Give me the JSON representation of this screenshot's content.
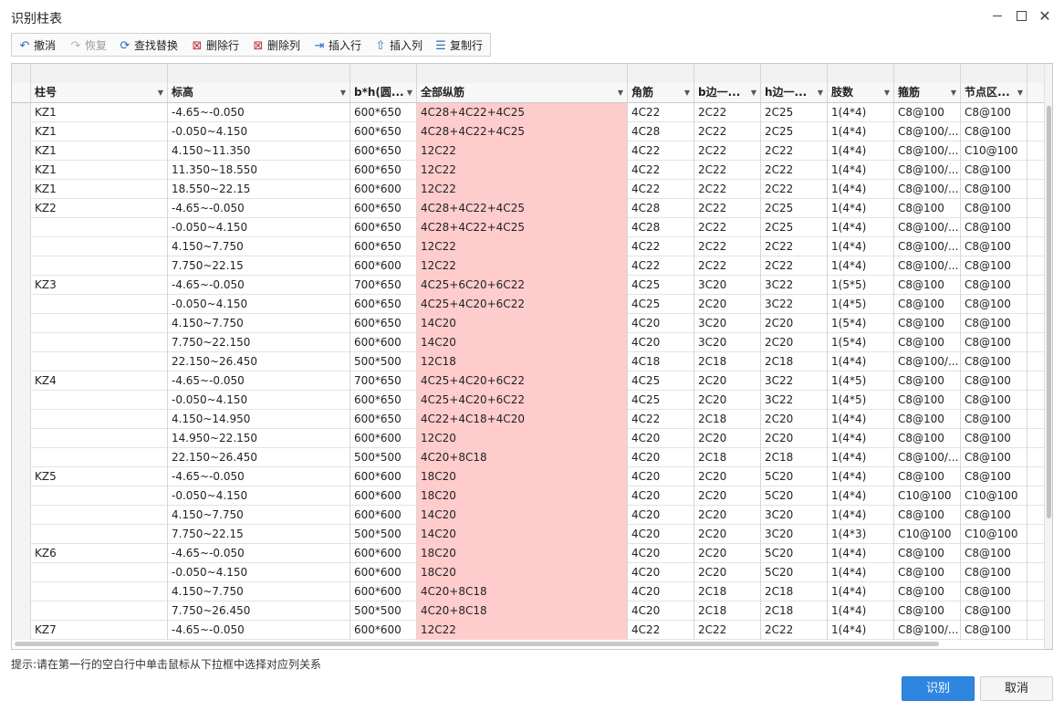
{
  "window": {
    "title": "识别柱表"
  },
  "toolbar": {
    "undo": "撤消",
    "redo": "恢复",
    "find_replace": "查找替换",
    "delete_row": "删除行",
    "delete_col": "删除列",
    "insert_row": "插入行",
    "insert_col": "插入列",
    "copy_row": "复制行"
  },
  "table": {
    "columns": [
      "柱号",
      "标高",
      "b*h(圆...",
      "全部纵筋",
      "角筋",
      "b边一...",
      "h边一...",
      "肢数",
      "箍筋",
      "节点区..."
    ],
    "rows": [
      [
        "KZ1",
        "-4.65~-0.050",
        "600*650",
        "4C28+4C22+4C25",
        "4C22",
        "2C22",
        "2C25",
        "1(4*4)",
        "C8@100",
        "C8@100"
      ],
      [
        "KZ1",
        "-0.050~4.150",
        "600*650",
        "4C28+4C22+4C25",
        "4C28",
        "2C22",
        "2C25",
        "1(4*4)",
        "C8@100/...",
        "C8@100"
      ],
      [
        "KZ1",
        "4.150~11.350",
        "600*650",
        "12C22",
        "4C22",
        "2C22",
        "2C22",
        "1(4*4)",
        "C8@100/...",
        "C10@100"
      ],
      [
        "KZ1",
        "11.350~18.550",
        "600*650",
        "12C22",
        "4C22",
        "2C22",
        "2C22",
        "1(4*4)",
        "C8@100/...",
        "C8@100"
      ],
      [
        "KZ1",
        "18.550~22.15",
        "600*600",
        "12C22",
        "4C22",
        "2C22",
        "2C22",
        "1(4*4)",
        "C8@100/...",
        "C8@100"
      ],
      [
        "KZ2",
        "-4.65~-0.050",
        "600*650",
        "4C28+4C22+4C25",
        "4C28",
        "2C22",
        "2C25",
        "1(4*4)",
        "C8@100",
        "C8@100"
      ],
      [
        "",
        "-0.050~4.150",
        "600*650",
        "4C28+4C22+4C25",
        "4C28",
        "2C22",
        "2C25",
        "1(4*4)",
        "C8@100/...",
        "C8@100"
      ],
      [
        "",
        "4.150~7.750",
        "600*650",
        "12C22",
        "4C22",
        "2C22",
        "2C22",
        "1(4*4)",
        "C8@100/...",
        "C8@100"
      ],
      [
        "",
        "7.750~22.15",
        "600*600",
        "12C22",
        "4C22",
        "2C22",
        "2C22",
        "1(4*4)",
        "C8@100/...",
        "C8@100"
      ],
      [
        "KZ3",
        "-4.65~-0.050",
        "700*650",
        "4C25+6C20+6C22",
        "4C25",
        "3C20",
        "3C22",
        "1(5*5)",
        "C8@100",
        "C8@100"
      ],
      [
        "",
        "-0.050~4.150",
        "600*650",
        "4C25+4C20+6C22",
        "4C25",
        "2C20",
        "3C22",
        "1(4*5)",
        "C8@100",
        "C8@100"
      ],
      [
        "",
        "4.150~7.750",
        "600*650",
        "14C20",
        "4C20",
        "3C20",
        "2C20",
        "1(5*4)",
        "C8@100",
        "C8@100"
      ],
      [
        "",
        "7.750~22.150",
        "600*600",
        "14C20",
        "4C20",
        "3C20",
        "2C20",
        "1(5*4)",
        "C8@100",
        "C8@100"
      ],
      [
        "",
        "22.150~26.450",
        "500*500",
        "12C18",
        "4C18",
        "2C18",
        "2C18",
        "1(4*4)",
        "C8@100/...",
        "C8@100"
      ],
      [
        "KZ4",
        "-4.65~-0.050",
        "700*650",
        "4C25+4C20+6C22",
        "4C25",
        "2C20",
        "3C22",
        "1(4*5)",
        "C8@100",
        "C8@100"
      ],
      [
        "",
        "-0.050~4.150",
        "600*650",
        "4C25+4C20+6C22",
        "4C25",
        "2C20",
        "3C22",
        "1(4*5)",
        "C8@100",
        "C8@100"
      ],
      [
        "",
        "4.150~14.950",
        "600*650",
        "4C22+4C18+4C20",
        "4C22",
        "2C18",
        "2C20",
        "1(4*4)",
        "C8@100",
        "C8@100"
      ],
      [
        "",
        "14.950~22.150",
        "600*600",
        "12C20",
        "4C20",
        "2C20",
        "2C20",
        "1(4*4)",
        "C8@100",
        "C8@100"
      ],
      [
        "",
        "22.150~26.450",
        "500*500",
        "4C20+8C18",
        "4C20",
        "2C18",
        "2C18",
        "1(4*4)",
        "C8@100/...",
        "C8@100"
      ],
      [
        "KZ5",
        "-4.65~-0.050",
        "600*600",
        "18C20",
        "4C20",
        "2C20",
        "5C20",
        "1(4*4)",
        "C8@100",
        "C8@100"
      ],
      [
        "",
        "-0.050~4.150",
        "600*600",
        "18C20",
        "4C20",
        "2C20",
        "5C20",
        "1(4*4)",
        "C10@100",
        "C10@100"
      ],
      [
        "",
        "4.150~7.750",
        "600*600",
        "14C20",
        "4C20",
        "2C20",
        "3C20",
        "1(4*4)",
        "C8@100",
        "C8@100"
      ],
      [
        "",
        "7.750~22.15",
        "500*500",
        "14C20",
        "4C20",
        "2C20",
        "3C20",
        "1(4*3)",
        "C10@100",
        "C10@100"
      ],
      [
        "KZ6",
        "-4.65~-0.050",
        "600*600",
        "18C20",
        "4C20",
        "2C20",
        "5C20",
        "1(4*4)",
        "C8@100",
        "C8@100"
      ],
      [
        "",
        "-0.050~4.150",
        "600*600",
        "18C20",
        "4C20",
        "2C20",
        "5C20",
        "1(4*4)",
        "C8@100",
        "C8@100"
      ],
      [
        "",
        "4.150~7.750",
        "600*600",
        "4C20+8C18",
        "4C20",
        "2C18",
        "2C18",
        "1(4*4)",
        "C8@100",
        "C8@100"
      ],
      [
        "",
        "7.750~26.450",
        "500*500",
        "4C20+8C18",
        "4C20",
        "2C18",
        "2C18",
        "1(4*4)",
        "C8@100",
        "C8@100"
      ],
      [
        "KZ7",
        "-4.65~-0.050",
        "600*600",
        "12C22",
        "4C22",
        "2C22",
        "2C22",
        "1(4*4)",
        "C8@100/...",
        "C8@100"
      ]
    ]
  },
  "hint": "提示:请在第一行的空白行中单击鼠标从下拉框中选择对应列关系",
  "buttons": {
    "recognize": "识别",
    "cancel": "取消"
  },
  "colors": {
    "highlight_column": "#ffcccc",
    "primary_button": "#2f86e0"
  }
}
